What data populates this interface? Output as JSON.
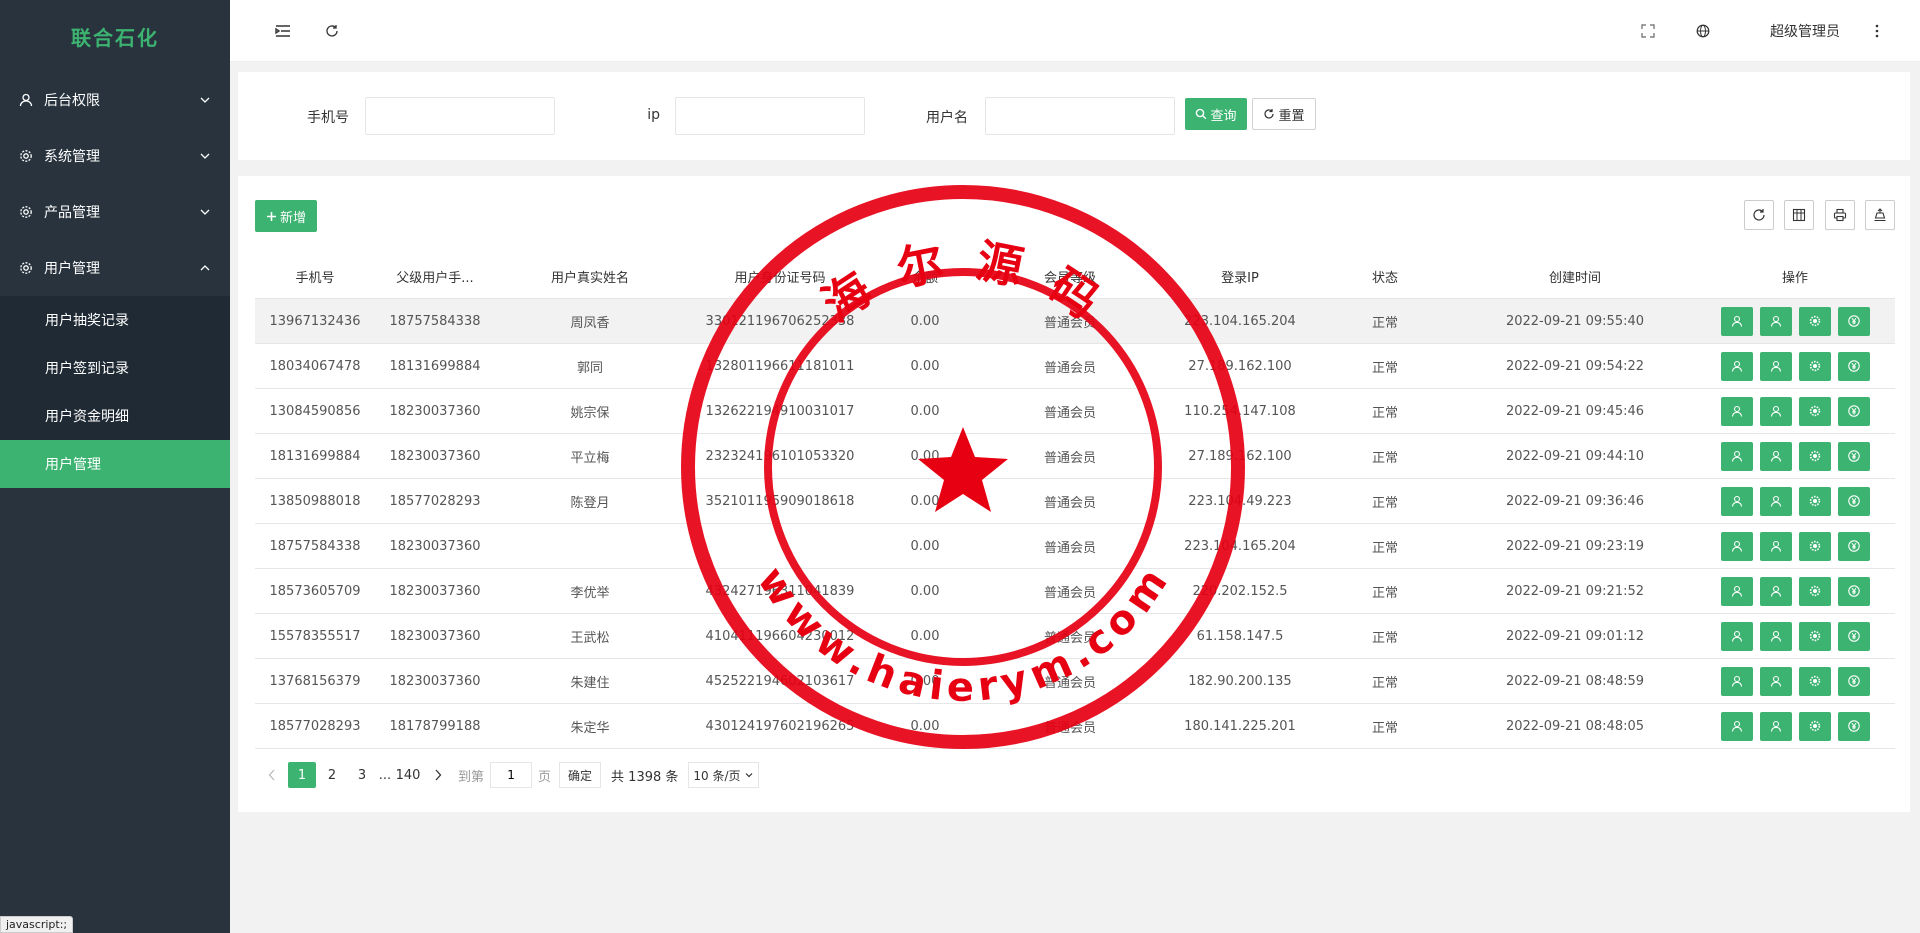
{
  "sidebar": {
    "logo": "联合石化",
    "menus": [
      {
        "label": "后台权限",
        "icon": "user-icon"
      },
      {
        "label": "系统管理",
        "icon": "gear-icon"
      },
      {
        "label": "产品管理",
        "icon": "gear-icon"
      },
      {
        "label": "用户管理",
        "icon": "gear-icon"
      }
    ],
    "submenu": [
      {
        "label": "用户抽奖记录"
      },
      {
        "label": "用户签到记录"
      },
      {
        "label": "用户资金明细"
      },
      {
        "label": "用户管理",
        "active": true
      }
    ],
    "status_tip": "javascript:;"
  },
  "header": {
    "user": "超级管理员",
    "icons": [
      "menu-fold-icon",
      "refresh-icon",
      "fullscreen-icon",
      "globe-icon",
      "more-vertical-icon"
    ]
  },
  "search": {
    "phone_label": "手机号",
    "ip_label": "ip",
    "username_label": "用户名",
    "phone_value": "",
    "ip_value": "",
    "username_value": "",
    "query_label": "查询",
    "reset_label": "重置"
  },
  "toolbar": {
    "add_label": "新增",
    "icons": [
      "refresh-icon",
      "columns-icon",
      "print-icon",
      "export-icon"
    ]
  },
  "table": {
    "headers": [
      "手机号",
      "父级用户手...",
      "用户真实姓名",
      "用户身份证号码",
      "余额",
      "会员等级",
      "登录IP",
      "状态",
      "创建时间",
      "操作"
    ],
    "rows": [
      [
        "13967132436",
        "18757584338",
        "周凤香",
        "330121196706252338",
        "0.00",
        "普通会员",
        "223.104.165.204",
        "正常",
        "2022-09-21 09:55:40"
      ],
      [
        "18034067478",
        "18131699884",
        "郭同",
        "132801196611181011",
        "0.00",
        "普通会员",
        "27.189.162.100",
        "正常",
        "2022-09-21 09:54:22"
      ],
      [
        "13084590856",
        "18230037360",
        "姚宗保",
        "132622194910031017",
        "0.00",
        "普通会员",
        "110.254.147.108",
        "正常",
        "2022-09-21 09:45:46"
      ],
      [
        "18131699884",
        "18230037360",
        "平立梅",
        "232324196101053320",
        "0.00",
        "普通会员",
        "27.189.162.100",
        "正常",
        "2022-09-21 09:44:10"
      ],
      [
        "13850988018",
        "18577028293",
        "陈登月",
        "352101195909018618",
        "0.00",
        "普通会员",
        "223.104.49.223",
        "正常",
        "2022-09-21 09:36:46"
      ],
      [
        "18757584338",
        "18230037360",
        "",
        "",
        "0.00",
        "普通会员",
        "223.104.165.204",
        "正常",
        "2022-09-21 09:23:19"
      ],
      [
        "18573605709",
        "18230037360",
        "李优举",
        "432427196311041839",
        "0.00",
        "普通会员",
        "220.202.152.5",
        "正常",
        "2022-09-21 09:21:52"
      ],
      [
        "15578355517",
        "18230037360",
        "王武松",
        "410411196604230012",
        "0.00",
        "普通会员",
        "61.158.147.5",
        "正常",
        "2022-09-21 09:01:12"
      ],
      [
        "13768156379",
        "18230037360",
        "朱建住",
        "452522194602103617",
        "0.00",
        "普通会员",
        "182.90.200.135",
        "正常",
        "2022-09-21 08:48:59"
      ],
      [
        "18577028293",
        "18178799188",
        "朱定华",
        "430124197602196265",
        "0.00",
        "普通会员",
        "180.141.225.201",
        "正常",
        "2022-09-21 08:48:05"
      ]
    ],
    "op_icons": [
      "user-icon",
      "user-edit-icon",
      "gear-icon",
      "yen-icon"
    ]
  },
  "pager": {
    "pages": [
      "1",
      "2",
      "3",
      "...",
      "140"
    ],
    "current": "1",
    "goto_label": "到第",
    "goto_value": "1",
    "page_unit": "页",
    "confirm_label": "确定",
    "total_text": "共 1398 条",
    "page_size": "10 条/页"
  },
  "stamp": {
    "top_text": "海 尔 源 码",
    "bottom_text": "www.haierym.com",
    "color": "#e60012"
  },
  "colors": {
    "accent": "#3cb371",
    "sidebar_bg": "#28333e"
  }
}
